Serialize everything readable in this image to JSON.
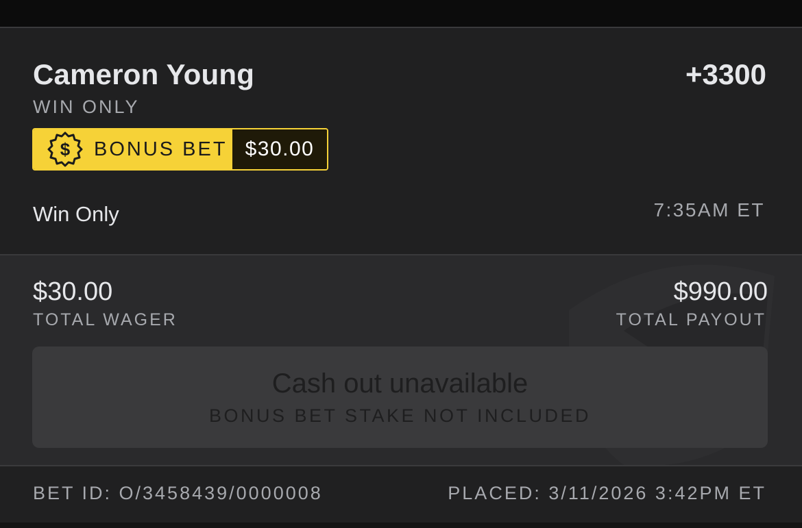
{
  "selection": {
    "player": "Cameron Young",
    "odds": "+3300",
    "market": "WIN ONLY",
    "bonus_label": "BONUS BET",
    "bonus_amount": "$30.00",
    "leg_label": "Win Only",
    "leg_time": "7:35AM ET"
  },
  "totals": {
    "wager_amount": "$30.00",
    "wager_label": "TOTAL WAGER",
    "payout_amount": "$990.00",
    "payout_label": "TOTAL PAYOUT"
  },
  "cashout": {
    "title": "Cash out unavailable",
    "subtitle": "BONUS BET STAKE NOT INCLUDED"
  },
  "footer": {
    "bet_id": "BET ID: O/3458439/0000008",
    "placed": "PLACED: 3/11/2026 3:42PM ET"
  },
  "icons": {
    "bonus": "dollar-badge-icon",
    "watermark": "shield-logo-icon"
  },
  "colors": {
    "accent": "#f6d237",
    "background": "#202021",
    "text_primary": "#e6e7ea",
    "text_secondary": "#a7a9ae"
  }
}
